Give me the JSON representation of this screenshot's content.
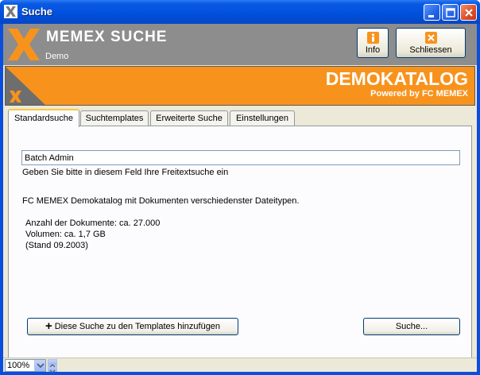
{
  "window": {
    "title": "Suche"
  },
  "header": {
    "app_name": "MEMEX SUCHE",
    "subtitle": "Demo",
    "info_label": "Info",
    "close_label": "Schliessen"
  },
  "banner": {
    "title": "DEMOKATALOG",
    "subtitle": "Powered by FC MEMEX"
  },
  "tabs": [
    {
      "label": "Standardsuche",
      "active": true
    },
    {
      "label": "Suchtemplates",
      "active": false
    },
    {
      "label": "Erweiterte Suche",
      "active": false
    },
    {
      "label": "Einstellungen",
      "active": false
    }
  ],
  "search": {
    "value": "Batch Admin",
    "hint": "Geben Sie bitte in diesem Feld Ihre Freitextsuche ein"
  },
  "description": {
    "line1": "FC MEMEX Demokatalog mit Dokumenten verschiedenster Dateitypen.",
    "doc_count": "Anzahl der Dokumente: ca. 27.000",
    "volume": "Volumen: ca. 1,7 GB",
    "status_date": "(Stand 09.2003)"
  },
  "buttons": {
    "add_template": "Diese Suche zu den Templates hinzufügen",
    "search": "Suche..."
  },
  "statusbar": {
    "zoom": "100%"
  },
  "colors": {
    "accent_orange": "#f7931d",
    "header_grey": "#8d8d8d",
    "xp_blue": "#0050dc"
  }
}
